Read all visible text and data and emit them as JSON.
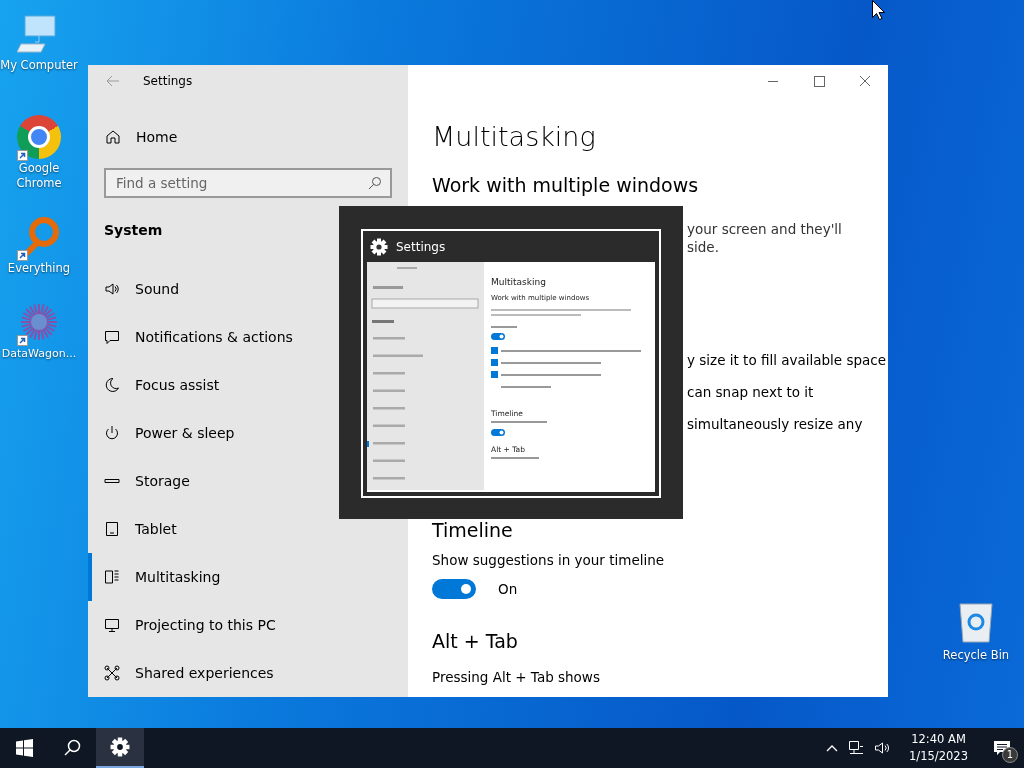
{
  "desktop_icons": [
    {
      "label": "My Computer",
      "kind": "computer",
      "shortcut": false
    },
    {
      "label": "Google Chrome",
      "kind": "browser",
      "shortcut": true
    },
    {
      "label": "Everything",
      "kind": "magnifier",
      "shortcut": true
    },
    {
      "label": "DataWagon...",
      "kind": "starburst",
      "shortcut": true
    }
  ],
  "recycle_bin": {
    "label": "Recycle Bin"
  },
  "window": {
    "title": "Settings",
    "home": "Home",
    "search": {
      "placeholder": "Find a setting"
    },
    "section": "System",
    "nav": [
      {
        "label": "Sound",
        "selected": false
      },
      {
        "label": "Notifications & actions",
        "selected": false
      },
      {
        "label": "Focus assist",
        "selected": false
      },
      {
        "label": "Power & sleep",
        "selected": false
      },
      {
        "label": "Storage",
        "selected": false
      },
      {
        "label": "Tablet",
        "selected": false
      },
      {
        "label": "Multitasking",
        "selected": true
      },
      {
        "label": "Projecting to this PC",
        "selected": false
      },
      {
        "label": "Shared experiences",
        "selected": false
      }
    ],
    "page_title": "Multitasking",
    "snap": {
      "heading": "Work with multiple windows",
      "description_visible": [
        "your screen and they'll",
        "side."
      ],
      "options_visible": [
        "y size it to fill available space",
        "can snap next to it",
        "simultaneously resize any"
      ]
    },
    "timeline": {
      "heading": "Timeline",
      "label": "Show suggestions in your timeline",
      "toggle": {
        "on": true,
        "label": "On"
      }
    },
    "alt_tab": {
      "heading": "Alt + Tab",
      "label": "Pressing Alt + Tab shows"
    }
  },
  "switcher": {
    "title": "Settings",
    "preview_headings": [
      "Multitasking",
      "Work with multiple windows",
      "Timeline",
      "Alt + Tab"
    ]
  },
  "taskbar": {
    "apps": [
      {
        "kind": "settings",
        "selected": true
      }
    ],
    "time": "12:40 AM",
    "date": "1/15/2023",
    "notification_count": "1"
  }
}
